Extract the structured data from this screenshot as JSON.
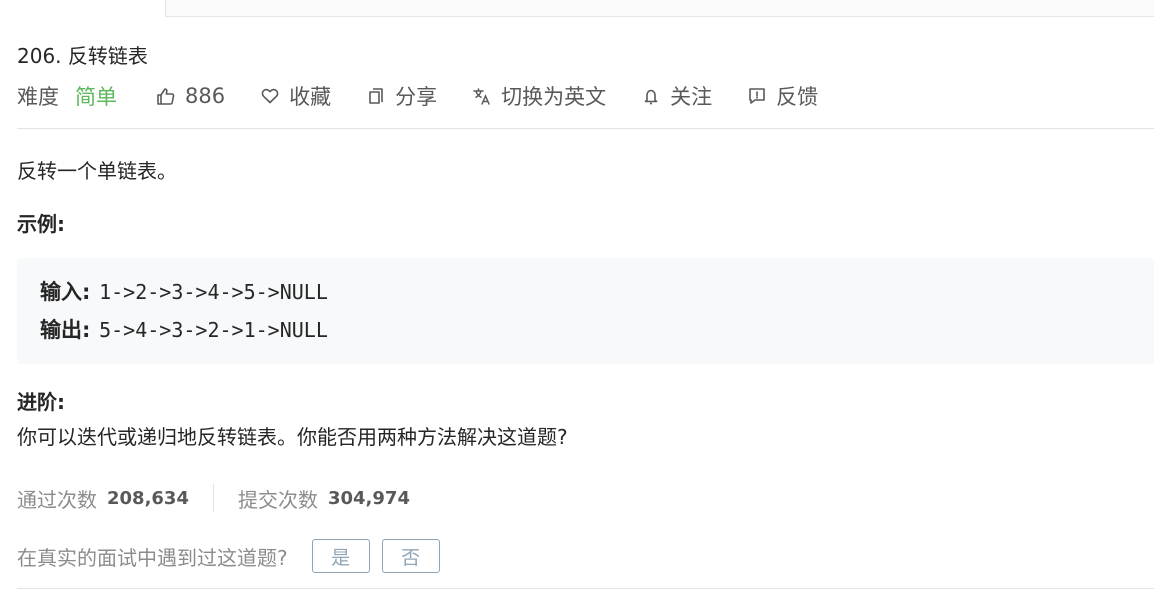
{
  "problem": {
    "title": "206. 反转链表",
    "difficulty_label": "难度",
    "difficulty_value": "简单",
    "likes": "886",
    "favorite_label": "收藏",
    "share_label": "分享",
    "translate_label": "切换为英文",
    "follow_label": "关注",
    "feedback_label": "反馈"
  },
  "description": {
    "text": "反转一个单链表。",
    "example_heading": "示例:",
    "example": {
      "input_label": "输入:",
      "input_value": "1->2->3->4->5->NULL",
      "output_label": "输出:",
      "output_value": "5->4->3->2->1->NULL"
    },
    "advance_heading": "进阶:",
    "advance_text": "你可以迭代或递归地反转链表。你能否用两种方法解决这道题?"
  },
  "stats": {
    "accepted_label": "通过次数",
    "accepted_value": "208,634",
    "submissions_label": "提交次数",
    "submissions_value": "304,974"
  },
  "interview": {
    "question": "在真实的面试中遇到过这道题?",
    "yes_label": "是",
    "no_label": "否"
  },
  "colors": {
    "difficulty_easy": "#5cb85c",
    "text_primary": "#262626",
    "text_secondary": "#8c8c8c",
    "button_border": "#8fa6b8"
  },
  "icons": {
    "likes": "thumbs-up-icon",
    "favorite": "heart-icon",
    "share": "share-icon",
    "translate": "translate-icon",
    "follow": "bell-icon",
    "feedback": "feedback-icon"
  }
}
